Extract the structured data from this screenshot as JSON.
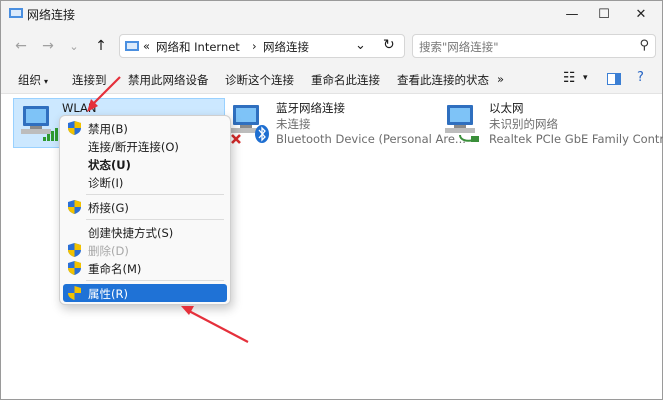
{
  "window": {
    "title": "网络连接",
    "minimize_icon": "—",
    "maximize_icon": "☐",
    "close_icon": "✕"
  },
  "nav": {
    "back_icon": "←",
    "forward_icon": "→",
    "history_icon": "⌄",
    "up_icon": "↑",
    "breadcrumb_prefix": "«",
    "breadcrumb": [
      "网络和 Internet",
      "网络连接"
    ],
    "breadcrumb_sep": "›",
    "address_dropdown_icon": "⌄",
    "refresh_icon": "↻",
    "search_placeholder": "搜索\"网络连接\"",
    "search_icon": "⚲"
  },
  "commands": {
    "organize": "组织",
    "connect_to": "连接到",
    "disable": "禁用此网络设备",
    "diagnose": "诊断这个连接",
    "rename": "重命名此连接",
    "view_status": "查看此连接的状态",
    "more": "»",
    "view_icon": "☷",
    "dropdown_icon": "▾"
  },
  "adapters": [
    {
      "name": "WLAN",
      "status": "",
      "device": ""
    },
    {
      "name": "蓝牙网络连接",
      "status": "未连接",
      "device": "Bluetooth Device (Personal Are..."
    },
    {
      "name": "以太网",
      "status": "未识别的网络",
      "device": "Realtek PCIe GbE Family Contr..."
    }
  ],
  "context_menu": {
    "items": [
      {
        "label": "禁用(B)",
        "shield": true
      },
      {
        "label": "连接/断开连接(O)",
        "shield": false
      },
      {
        "label": "状态(U)",
        "shield": false
      },
      {
        "label": "诊断(I)",
        "shield": false
      },
      {
        "label": "桥接(G)",
        "shield": true
      },
      {
        "label": "创建快捷方式(S)",
        "shield": false
      },
      {
        "label": "删除(D)",
        "shield": true
      },
      {
        "label": "重命名(M)",
        "shield": true
      },
      {
        "label": "属性(R)",
        "shield": true
      }
    ]
  },
  "colors": {
    "accent": "#1f72d6",
    "selection": "#cce8ff",
    "annotation_arrow": "#e5303b"
  }
}
